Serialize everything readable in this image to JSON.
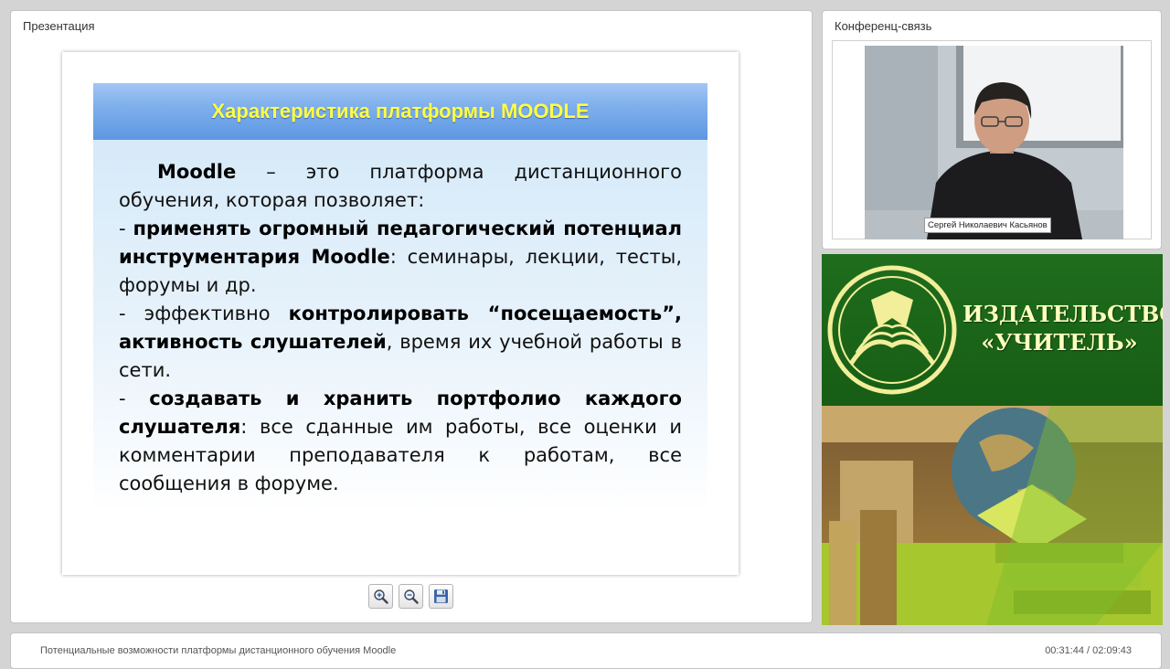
{
  "presentation_panel": {
    "title": "Презентация"
  },
  "slide": {
    "heading": "Характеристика платформы MOODLE",
    "para1_bold": "Moodle",
    "para1_text": " – это платформа дистанционного обучения, которая позволяет:",
    "item1_dash": "- ",
    "item1_bold": "применять огромный педагогический потенциал инструментария Moodle",
    "item1_text": ": семинары, лекции, тесты, форумы и др.",
    "item2_text": "- эффективно ",
    "item2_bold": "контролировать “посещаемость”, активность слушателей",
    "item2_text2": ", время их учебной работы в сети.",
    "item3_dash": "- ",
    "item3_bold": "создавать и хранить портфолио каждого слушателя",
    "item3_text": ": все сданные им работы, все оценки и комментарии преподавателя к работам, все сообщения в форуме."
  },
  "toolbar": {
    "zoom_in_icon": "zoom-in-icon",
    "zoom_out_icon": "zoom-out-icon",
    "save_icon": "floppy-disk-icon"
  },
  "conference_panel": {
    "title": "Конференц-связь",
    "speaker_name": "Сергей Николаевич Касьянов"
  },
  "banner": {
    "publisher_line1": "ИЗДАТЕЛЬСТВО",
    "publisher_line2": "«УЧИТЕЛЬ»"
  },
  "status_bar": {
    "title": "Потенциальные возможности платформы дистанционного обучения Moodle",
    "time": "00:31:44 / 02:09:43"
  },
  "colors": {
    "slide_heading_text": "#ffff46",
    "slide_heading_bg": "#6ea3e8",
    "banner_green": "#1d6a1b"
  }
}
